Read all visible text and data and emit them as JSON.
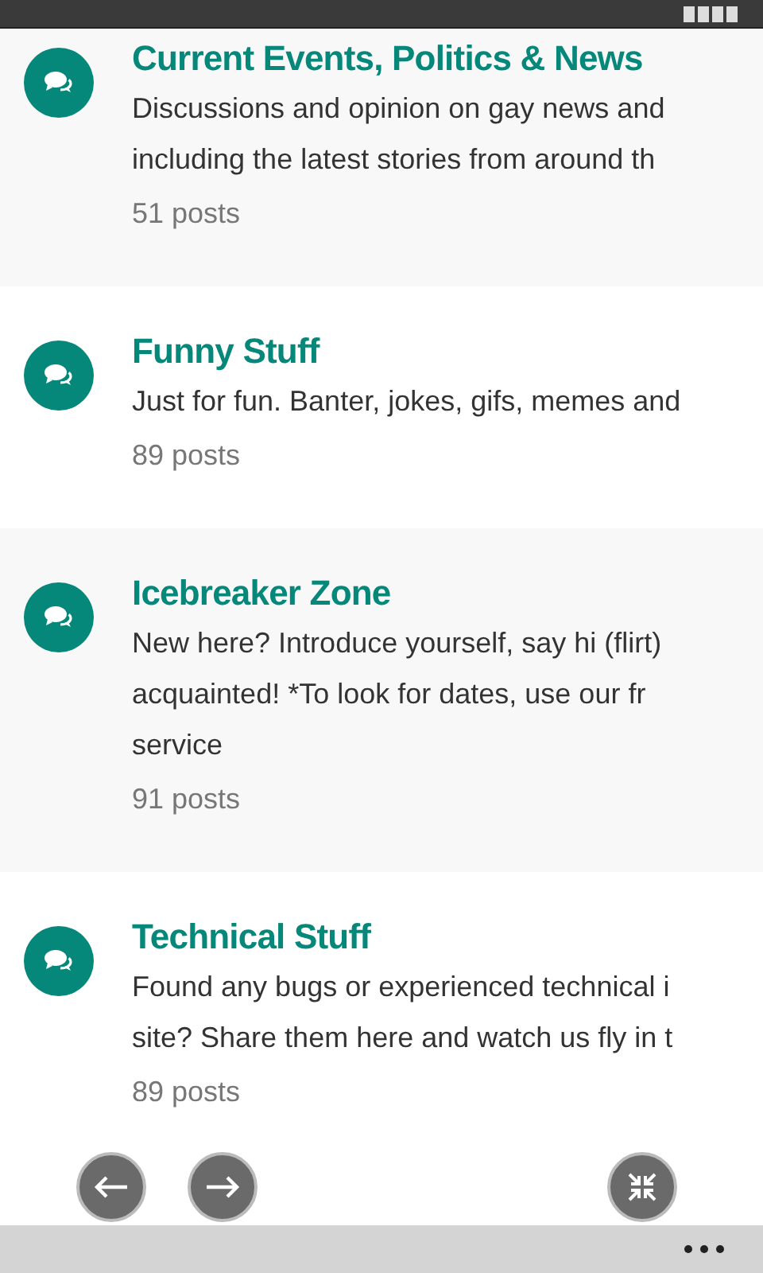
{
  "forums": [
    {
      "title": "Current Events, Politics & News",
      "description_lines": [
        "Discussions and opinion on gay news and",
        "including the latest stories from around th"
      ],
      "posts": "51 posts"
    },
    {
      "title": "Funny Stuff",
      "description_lines": [
        "Just for fun. Banter, jokes, gifs, memes and"
      ],
      "posts": "89 posts"
    },
    {
      "title": "Icebreaker Zone",
      "description_lines": [
        "New here? Introduce yourself, say hi (flirt)",
        "acquainted!  *To look for dates, use our fr",
        "service"
      ],
      "posts": "91 posts"
    },
    {
      "title": "Technical Stuff",
      "description_lines": [
        "Found any bugs or experienced technical i",
        "site? Share them here and watch us fly in t"
      ],
      "posts": "89 posts"
    }
  ]
}
